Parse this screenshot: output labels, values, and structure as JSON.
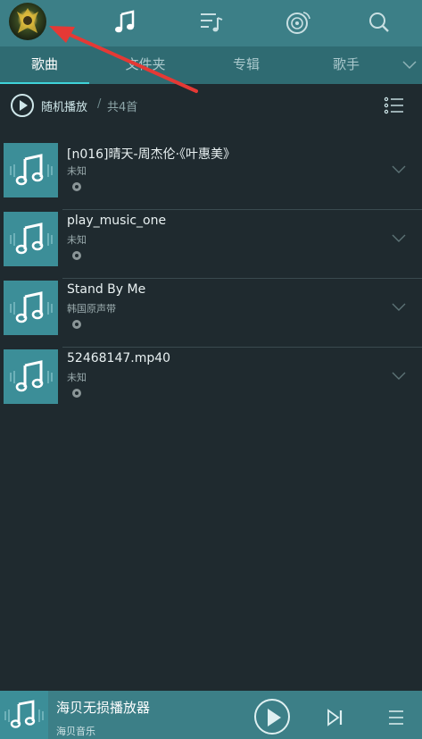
{
  "topbar": {
    "icons": [
      "avatar",
      "music-note-icon",
      "playlist-icon",
      "radio-disc-icon",
      "search-icon"
    ]
  },
  "tabs": [
    {
      "label": "歌曲",
      "active": true
    },
    {
      "label": "文件夹",
      "active": false
    },
    {
      "label": "专辑",
      "active": false
    },
    {
      "label": "歌手",
      "active": false
    }
  ],
  "play_all": {
    "label": "随机播放",
    "separator": "/",
    "count": "共4首"
  },
  "songs": [
    {
      "title": "[n016]晴天-周杰伦·《叶惠美》",
      "artist": "未知"
    },
    {
      "title": "play_music_one",
      "artist": "未知"
    },
    {
      "title": "Stand By Me",
      "artist": "韩国原声带"
    },
    {
      "title": "52468147.mp40",
      "artist": "未知"
    }
  ],
  "player": {
    "title": "海贝无损播放器",
    "subtitle": "海贝音乐"
  },
  "colors": {
    "topbar": "#3c7f87",
    "tabbar": "#2f6b72",
    "accent": "#3fd2d8",
    "background": "#1f2a2f",
    "cover": "#3c8e98"
  }
}
